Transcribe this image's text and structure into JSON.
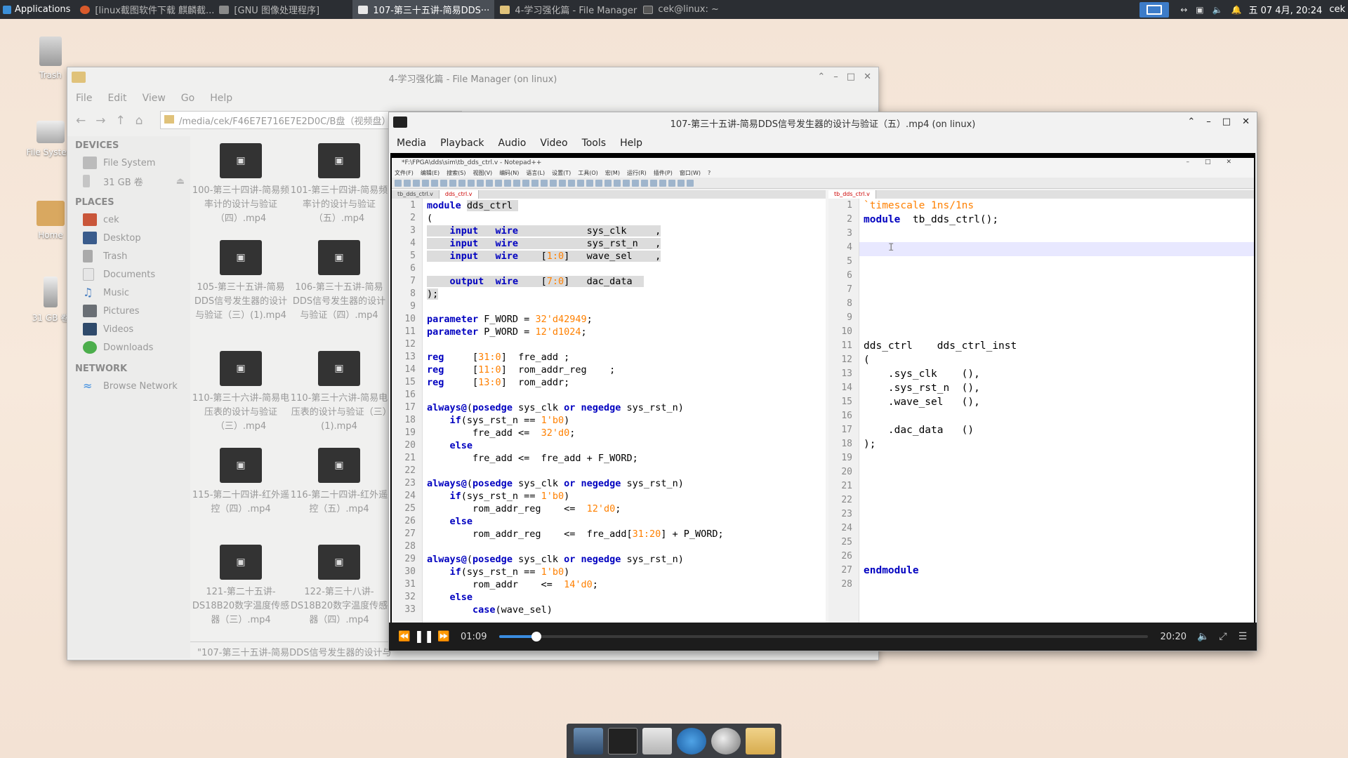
{
  "panel": {
    "applications": "Applications",
    "tasks": [
      {
        "label": "[linux截图软件下载 麒麟截...",
        "icon": "firefox-icon",
        "color": "#d95a2b"
      },
      {
        "label": "[GNU 图像处理程序]",
        "icon": "gimp-icon",
        "color": "#8a8a8a"
      },
      {
        "label": "107-第三十五讲-简易DDS···",
        "icon": "vlc-icon",
        "color": "#e8e8e8"
      },
      {
        "label": "4-学习强化篇 - File Manager",
        "icon": "folder-icon",
        "color": "#e0c27a"
      },
      {
        "label": "cek@linux: ~",
        "icon": "terminal-icon",
        "color": "#555"
      }
    ],
    "clock": "五 07 4月, 20:24",
    "user": "cek"
  },
  "desktop": {
    "icons": [
      {
        "label": "Trash",
        "icon": "trash-icon"
      },
      {
        "label": "File System",
        "icon": "drive-icon"
      },
      {
        "label": "Home",
        "icon": "home-folder-icon"
      },
      {
        "label": "31 GB 卷",
        "icon": "usb-drive-icon"
      }
    ]
  },
  "file_manager": {
    "title": "4-学习强化篇 - File Manager (on linux)",
    "menu": [
      "File",
      "Edit",
      "View",
      "Go",
      "Help"
    ],
    "path": "/media/cek/F46E7E716E7E2D0C/B盘（视频盘）/4",
    "devices_header": "DEVICES",
    "devices": [
      {
        "label": "File System",
        "icon": "drive-icon"
      },
      {
        "label": "31 GB 卷",
        "icon": "usb-drive-icon"
      }
    ],
    "places_header": "PLACES",
    "places": [
      {
        "label": "cek",
        "icon": "home-icon"
      },
      {
        "label": "Desktop",
        "icon": "desktop-icon"
      },
      {
        "label": "Trash",
        "icon": "trash-icon"
      },
      {
        "label": "Documents",
        "icon": "documents-icon"
      },
      {
        "label": "Music",
        "icon": "music-icon"
      },
      {
        "label": "Pictures",
        "icon": "pictures-icon"
      },
      {
        "label": "Videos",
        "icon": "videos-icon"
      },
      {
        "label": "Downloads",
        "icon": "downloads-icon"
      }
    ],
    "network_header": "NETWORK",
    "network": [
      {
        "label": "Browse Network",
        "icon": "network-icon"
      }
    ],
    "files": [
      "100-第三十四讲-简易频率计的设计与验证（四）.mp4",
      "101-第三十四讲-简易频率计的设计与验证（五）.mp4",
      "105-第三十五讲-简易DDS信号发生器的设计与验证（三）(1).mp4",
      "106-第三十五讲-简易DDS信号发生器的设计与验证（四）.mp4",
      "110-第三十六讲-简易电压表的设计与验证（三）.mp4",
      "110-第三十六讲-简易电压表的设计与验证（三）(1).mp4",
      "115-第二十四讲-红外遥控（四）.mp4",
      "116-第二十四讲-红外遥控（五）.mp4",
      "121-第二十五讲-DS18B20数字温度传感器（三）.mp4",
      "122-第三十八讲-DS18B20数字温度传感器（四）.mp4"
    ],
    "status": "\"107-第三十五讲-简易DDS信号发生器的设计与"
  },
  "vlc": {
    "title": "107-第三十五讲-简易DDS信号发生器的设计与验证（五）.mp4 (on linux)",
    "menu": [
      "Media",
      "Playback",
      "Audio",
      "Video",
      "Tools",
      "Help"
    ],
    "elapsed": "01:09",
    "total": "20:20",
    "progress": 0.057
  },
  "notepad": {
    "title": "*F:\\FPGA\\dds\\sim\\tb_dds_ctrl.v - Notepad++",
    "menu": [
      "文件(F)",
      "编辑(E)",
      "搜索(S)",
      "视图(V)",
      "编码(N)",
      "语言(L)",
      "设置(T)",
      "工具(O)",
      "宏(M)",
      "运行(R)",
      "插件(P)",
      "窗口(W)",
      "?"
    ],
    "left_tabs": [
      "tb_dds_ctrl.v",
      "dds_ctrl.v"
    ],
    "right_tab": "tb_dds_ctrl.v"
  }
}
